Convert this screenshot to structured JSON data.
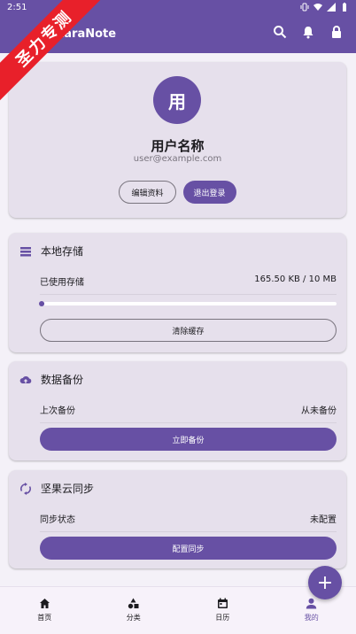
{
  "status_bar": {
    "time": "2:51"
  },
  "app_bar": {
    "title": "LaraNote"
  },
  "ribbon": {
    "text": "圣力专测"
  },
  "profile": {
    "avatar_text": "用",
    "name": "用户名称",
    "email": "user@example.com",
    "edit_label": "编辑资料",
    "logout_label": "退出登录"
  },
  "storage": {
    "title": "本地存储",
    "used_label": "已使用存储",
    "used_value": "165.50 KB / 10 MB",
    "progress_percent": 1.6,
    "clear_label": "清除缓存"
  },
  "backup": {
    "title": "数据备份",
    "last_label": "上次备份",
    "last_value": "从未备份",
    "action_label": "立即备份"
  },
  "sync": {
    "title": "坚果云同步",
    "status_label": "同步状态",
    "status_value": "未配置",
    "action_label": "配置同步"
  },
  "fab": {
    "label": "+"
  },
  "nav": {
    "home": "首页",
    "category": "分类",
    "calendar": "日历",
    "mine": "我的"
  },
  "colors": {
    "primary": "#6750a4",
    "surface": "#e6e0ec",
    "ribbon": "#e8202a"
  }
}
